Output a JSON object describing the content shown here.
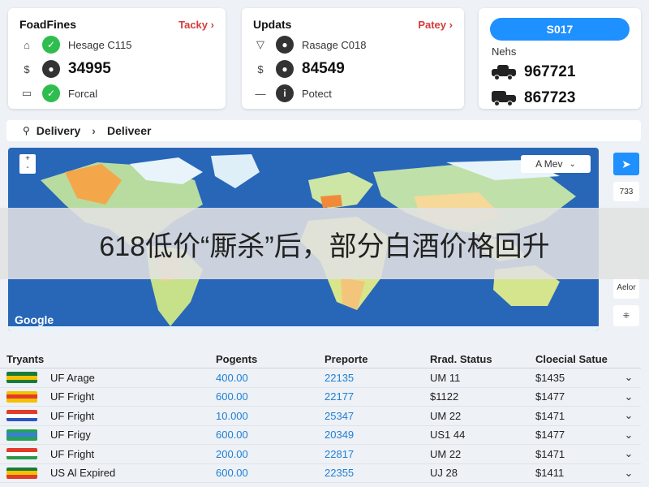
{
  "cards": [
    {
      "title": "FoadFines",
      "link": "Tacky",
      "rows": [
        {
          "lead": "⌂",
          "circle_glyph": "✓",
          "circle_color": "#2ebd4e",
          "text": "Hesage C115",
          "big": false
        },
        {
          "lead": "$",
          "circle_glyph": "●",
          "circle_color": "#333333",
          "text": "34995",
          "big": true
        },
        {
          "lead": "▭",
          "circle_glyph": "✓",
          "circle_color": "#2ebd4e",
          "text": "Forcal",
          "big": false
        }
      ]
    },
    {
      "title": "Updats",
      "link": "Patey",
      "rows": [
        {
          "lead": "▽",
          "circle_glyph": "●",
          "circle_color": "#333333",
          "text": "Rasage C018",
          "big": false
        },
        {
          "lead": "$",
          "circle_glyph": "●",
          "circle_color": "#333333",
          "text": "84549",
          "big": true
        },
        {
          "lead": "—",
          "circle_glyph": "i",
          "circle_color": "#333333",
          "text": "Potect",
          "big": false
        }
      ]
    }
  ],
  "summary": {
    "button": "S017",
    "label": "Nehs",
    "values": [
      "967721",
      "867723"
    ]
  },
  "breadcrumb": {
    "first": "Delivery",
    "second": "Deliveer"
  },
  "map": {
    "dropdown": "A Mev",
    "brand": "Google",
    "zoom_in": "+",
    "zoom_out": "-"
  },
  "side_buttons": [
    "➤",
    "733",
    "Aelor",
    "⁜"
  ],
  "banner": "618低价“厮杀”后，部分白酒价格回升",
  "table": {
    "headers": [
      "Tryants",
      "Pogents",
      "Preporte",
      "Rrad. Status",
      "Cloecial Satue"
    ],
    "rows": [
      {
        "flag": [
          "#1a7a3c",
          "#f2c200",
          "#1a7a3c"
        ],
        "name": "UF Arage",
        "pay": "400.00",
        "ref": "22135",
        "status": "UM 11",
        "amount": "$1435"
      },
      {
        "flag": [
          "#f2c200",
          "#e23b2a",
          "#f2c200"
        ],
        "name": "UF Fright",
        "pay": "600.00",
        "ref": "22177",
        "status": "$1122",
        "amount": "$1477"
      },
      {
        "flag": [
          "#e23b2a",
          "#ffffff",
          "#2a54c4"
        ],
        "name": "UF Fright",
        "pay": "10.000",
        "ref": "25347",
        "status": "UM 22",
        "amount": "$1471"
      },
      {
        "flag": [
          "#25a15a",
          "#3a7fd6",
          "#25a15a"
        ],
        "name": "UF Frigy",
        "pay": "600.00",
        "ref": "20349",
        "status": "US1 44",
        "amount": "$1477"
      },
      {
        "flag": [
          "#e23b2a",
          "#ffffff",
          "#2a9a4a"
        ],
        "name": "UF Fright",
        "pay": "200.00",
        "ref": "22817",
        "status": "UM 22",
        "amount": "$1471"
      },
      {
        "flag": [
          "#1a7a3c",
          "#f2c200",
          "#e23b2a"
        ],
        "name": "US Al Expired",
        "pay": "600.00",
        "ref": "22355",
        "status": "UJ 28",
        "amount": "$1411"
      }
    ]
  },
  "colors": {
    "accent": "#1e90ff",
    "link": "#d63a3a",
    "value": "#1e7fd6",
    "map_ocean": "#2866b8"
  }
}
